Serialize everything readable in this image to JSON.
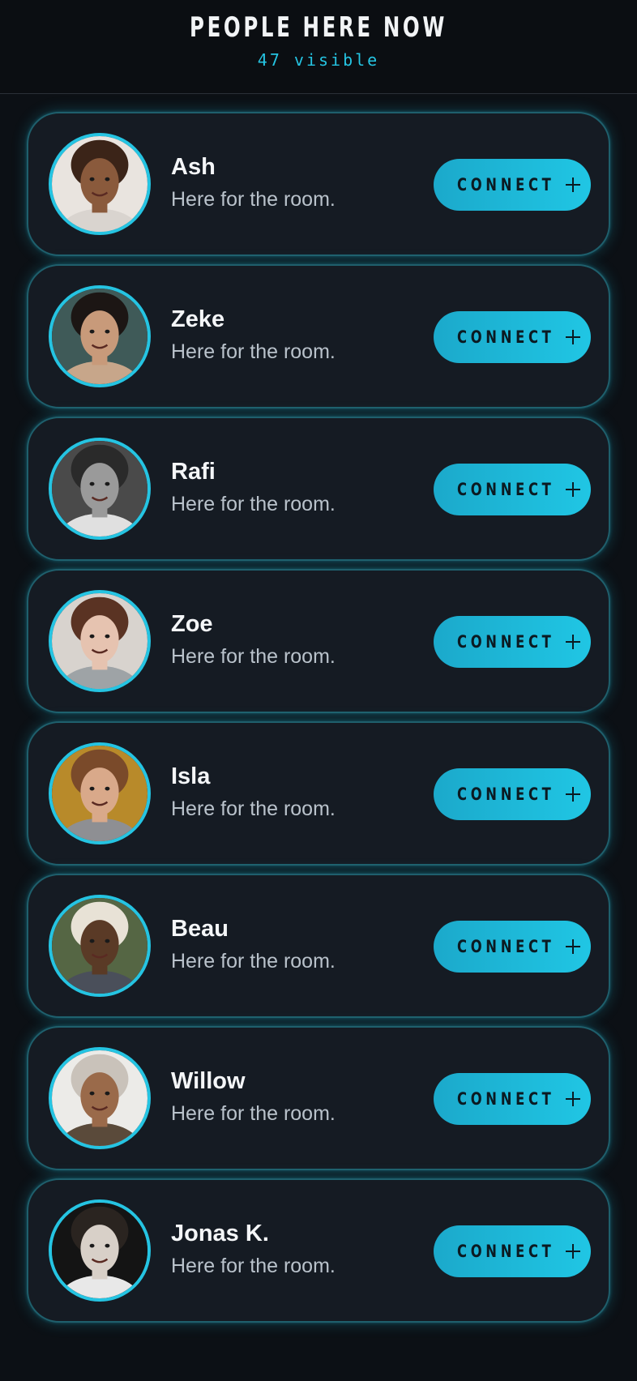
{
  "header": {
    "title": "PEOPLE HERE NOW",
    "subtitle": "47 visible"
  },
  "accent_color": "#25c4e2",
  "people": [
    {
      "name": "Ash",
      "status": "Here for the room.",
      "connect_label": "CONNECT",
      "avatar": "woman-long-dark-hair-avatar",
      "skin": "#8a5a3c",
      "hair": "#3b2418",
      "bg": "#e9e4df",
      "top": "#d9d4cf"
    },
    {
      "name": "Zeke",
      "status": "Here for the room.",
      "connect_label": "CONNECT",
      "avatar": "man-eyes-closed-avatar",
      "skin": "#c89a7a",
      "hair": "#1c1614",
      "bg": "#3f5a58",
      "top": "#c7a68a"
    },
    {
      "name": "Rafi",
      "status": "Here for the room.",
      "connect_label": "CONNECT",
      "avatar": "man-sunglasses-bw-avatar",
      "skin": "#9a9a9a",
      "hair": "#2a2a2a",
      "bg": "#4a4a4a",
      "top": "#e0e0e0"
    },
    {
      "name": "Zoe",
      "status": "Here for the room.",
      "connect_label": "CONNECT",
      "avatar": "woman-scarf-avatar",
      "skin": "#e6c3b0",
      "hair": "#5a3323",
      "bg": "#d8d3ce",
      "top": "#9ea3a6"
    },
    {
      "name": "Isla",
      "status": "Here for the room.",
      "connect_label": "CONNECT",
      "avatar": "woman-hood-avatar",
      "skin": "#d9a98a",
      "hair": "#7a4a2a",
      "bg": "#b88a2a",
      "top": "#8e8f93"
    },
    {
      "name": "Beau",
      "status": "Here for the room.",
      "connect_label": "CONNECT",
      "avatar": "man-hat-suit-avatar",
      "skin": "#5a3a26",
      "hair": "#e8e2d6",
      "bg": "#556644",
      "top": "#4a4f5a"
    },
    {
      "name": "Willow",
      "status": "Here for the room.",
      "connect_label": "CONNECT",
      "avatar": "woman-beanie-avatar",
      "skin": "#9a6a4a",
      "hair": "#c9c2ba",
      "bg": "#ecebe8",
      "top": "#5a4a3a"
    },
    {
      "name": "Jonas K.",
      "status": "Here for the room.",
      "connect_label": "CONNECT",
      "avatar": "man-curly-hair-avatar",
      "skin": "#d8d0c8",
      "hair": "#2a2420",
      "bg": "#141414",
      "top": "#e8e8e8"
    }
  ]
}
